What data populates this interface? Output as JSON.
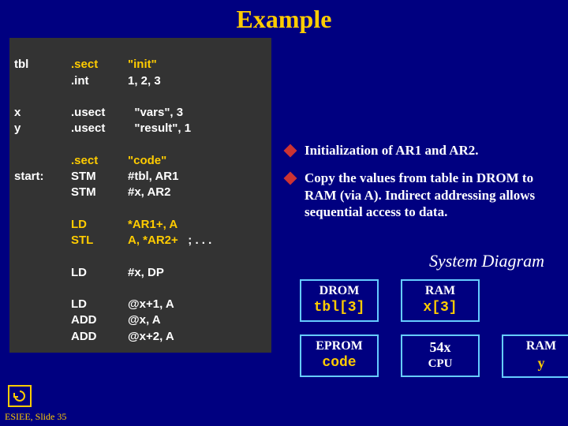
{
  "title": "Example",
  "code": {
    "l1_lbl": "tbl",
    "l1_op": ".sect",
    "l1_ar": "\"init\"",
    "l2_op": ".int",
    "l2_ar": "1, 2, 3",
    "l3_lbl": "x",
    "l3_op": ".usect",
    "l3_ar": "\"vars\", 3",
    "l4_lbl": "y",
    "l4_op": ".usect",
    "l4_ar": "\"result\", 1",
    "l5_op": ".sect",
    "l5_ar": "\"code\"",
    "l6_lbl": "start:",
    "l6_op": "STM",
    "l6_ar": "#tbl, AR1",
    "l7_op": "STM",
    "l7_ar": "#x, AR2",
    "l8_op": "LD",
    "l8_ar": "*AR1+, A",
    "l9_op": "STL",
    "l9_ar": "A, *AR2+",
    "l9_cm": "; . . .",
    "l10_op": "LD",
    "l10_ar": "#x, DP",
    "l11_op": "LD",
    "l11_ar": "@x+1, A",
    "l12_op": "ADD",
    "l12_ar": "@x, A",
    "l13_op": "ADD",
    "l13_ar": "@x+2, A"
  },
  "bullets": [
    "Initialization of AR1 and AR2.",
    "Copy the values from table in DROM to RAM (via A). Indirect addressing allows sequential access to data."
  ],
  "diagram": {
    "title": "System Diagram",
    "drom_hdr": "DROM",
    "drom_val": "tbl[3]",
    "ram1_hdr": "RAM",
    "ram1_val": "x[3]",
    "eprom_hdr": "EPROM",
    "eprom_val": "code",
    "cpu_l1": "54x",
    "cpu_l2": "CPU",
    "ram2_hdr": "RAM",
    "ram2_val": "y"
  },
  "footer": "ESIEE, Slide 35"
}
